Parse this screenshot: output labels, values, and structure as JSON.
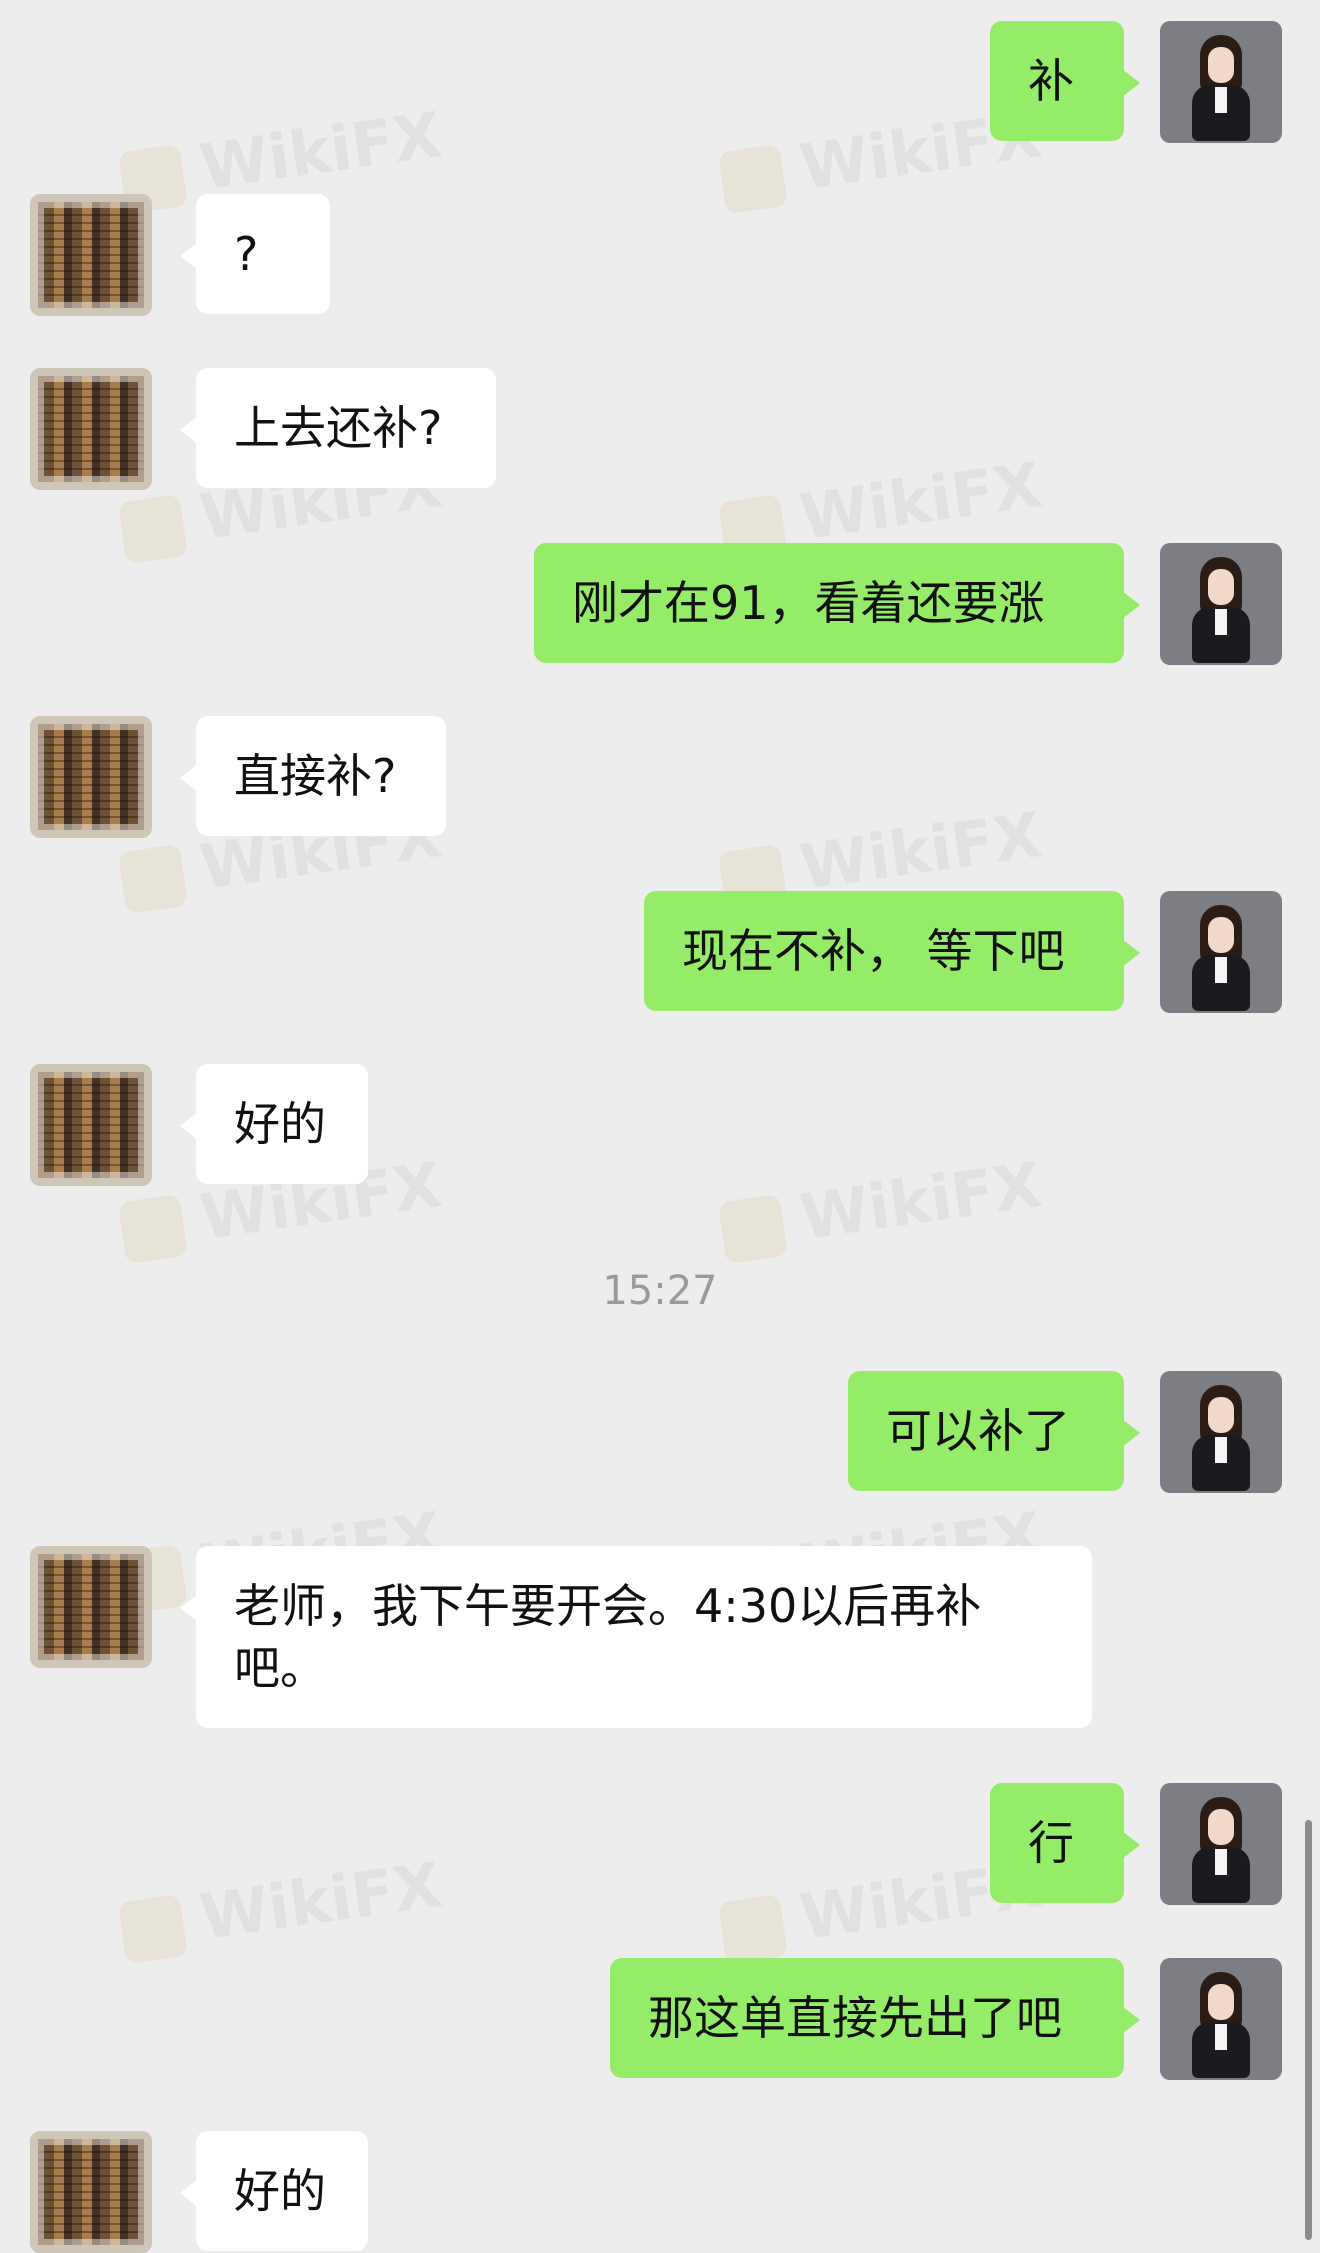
{
  "watermark": "WikiFX",
  "messages": [
    {
      "from": "me",
      "text": "补"
    },
    {
      "from": "other",
      "text": "?"
    },
    {
      "from": "other",
      "text": "上去还补?"
    },
    {
      "from": "me",
      "text": "刚才在91，看着还要涨"
    },
    {
      "from": "other",
      "text": "直接补?"
    },
    {
      "from": "me",
      "text": "现在不补，  等下吧"
    },
    {
      "from": "other",
      "text": "好的"
    },
    {
      "from": "me",
      "text": "可以补了"
    },
    {
      "from": "other",
      "text": "老师，我下午要开会。4:30以后再补吧。"
    },
    {
      "from": "me",
      "text": "行"
    },
    {
      "from": "me",
      "text": "那这单直接先出了吧"
    },
    {
      "from": "other",
      "text": "好的"
    }
  ],
  "timestamp": "15:27",
  "icons": [
    "avatar-me-icon",
    "avatar-other-icon",
    "wikifx-logo-icon"
  ],
  "colors": {
    "background": "#ededed",
    "me_bubble": "#95ec69",
    "other_bubble": "#ffffff",
    "timestamp_text": "#9a9a9a"
  }
}
